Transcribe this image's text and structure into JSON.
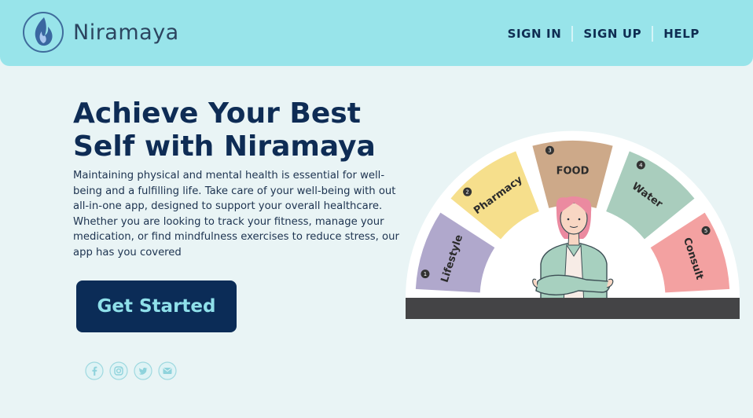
{
  "brand": {
    "name": "Niramaya"
  },
  "nav": {
    "signin": "SIGN IN",
    "signup": "SIGN UP",
    "help": "HELP"
  },
  "hero": {
    "headline_line1": "Achieve Your Best",
    "headline_line2": "Self with Niramaya",
    "description": "Maintaining physical and mental health is essential for well-being and a fulfilling life.  Take care of your well-being with out all-in-one app, designed to support your overall healthcare. Whether you are looking to track your fitness, manage your medication, or find mindfulness exercises to reduce stress, our app has you covered",
    "cta_label": "Get Started"
  },
  "social": [
    "facebook-icon",
    "instagram-icon",
    "twitter-icon",
    "email-icon"
  ],
  "dial": {
    "segments": [
      {
        "number": "1",
        "label": "Lifestyle",
        "color": "#b0a8cc"
      },
      {
        "number": "2",
        "label": "Pharmacy",
        "color": "#f6df8c"
      },
      {
        "number": "3",
        "label": "FOOD",
        "color": "#cda989"
      },
      {
        "number": "4",
        "label": "Water",
        "color": "#a9cdbd"
      },
      {
        "number": "5",
        "label": "Consult",
        "color": "#f3a1a1"
      }
    ]
  },
  "colors": {
    "topbar": "#98e4ea",
    "page": "#e9f4f5",
    "navy": "#0e2c55",
    "accent": "#8fe0ea"
  }
}
